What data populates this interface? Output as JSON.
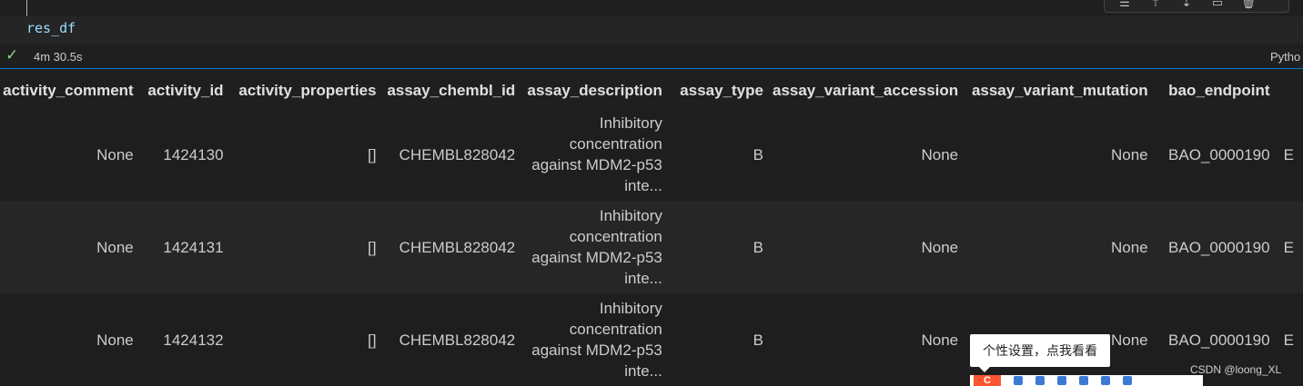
{
  "cell": {
    "code": "res_df",
    "exec_time": "4m 30.5s",
    "kernel": "Pytho"
  },
  "toolbar": {
    "icons": [
      "run-by-line-icon",
      "execute-above-icon",
      "execute-below-icon",
      "split-cell-icon",
      "delete-icon"
    ]
  },
  "table": {
    "columns": [
      "activity_comment",
      "activity_id",
      "activity_properties",
      "assay_chembl_id",
      "assay_description",
      "assay_type",
      "assay_variant_accession",
      "assay_variant_mutation",
      "bao_endpoint"
    ],
    "rows": [
      [
        "None",
        "1424130",
        "[]",
        "CHEMBL828042",
        "Inhibitory concentration against MDM2-p53 inte...",
        "B",
        "None",
        "None",
        "BAO_0000190",
        "E"
      ],
      [
        "None",
        "1424131",
        "[]",
        "CHEMBL828042",
        "Inhibitory concentration against MDM2-p53 inte...",
        "B",
        "None",
        "None",
        "BAO_0000190",
        "E"
      ],
      [
        "None",
        "1424132",
        "[]",
        "CHEMBL828042",
        "Inhibitory concentration against MDM2-p53 inte...",
        "B",
        "None",
        "None",
        "BAO_0000190",
        "E"
      ]
    ]
  },
  "popup": {
    "tooltip": "个性设置，点我看看",
    "badge": "C"
  },
  "watermark": "CSDN @loong_XL"
}
